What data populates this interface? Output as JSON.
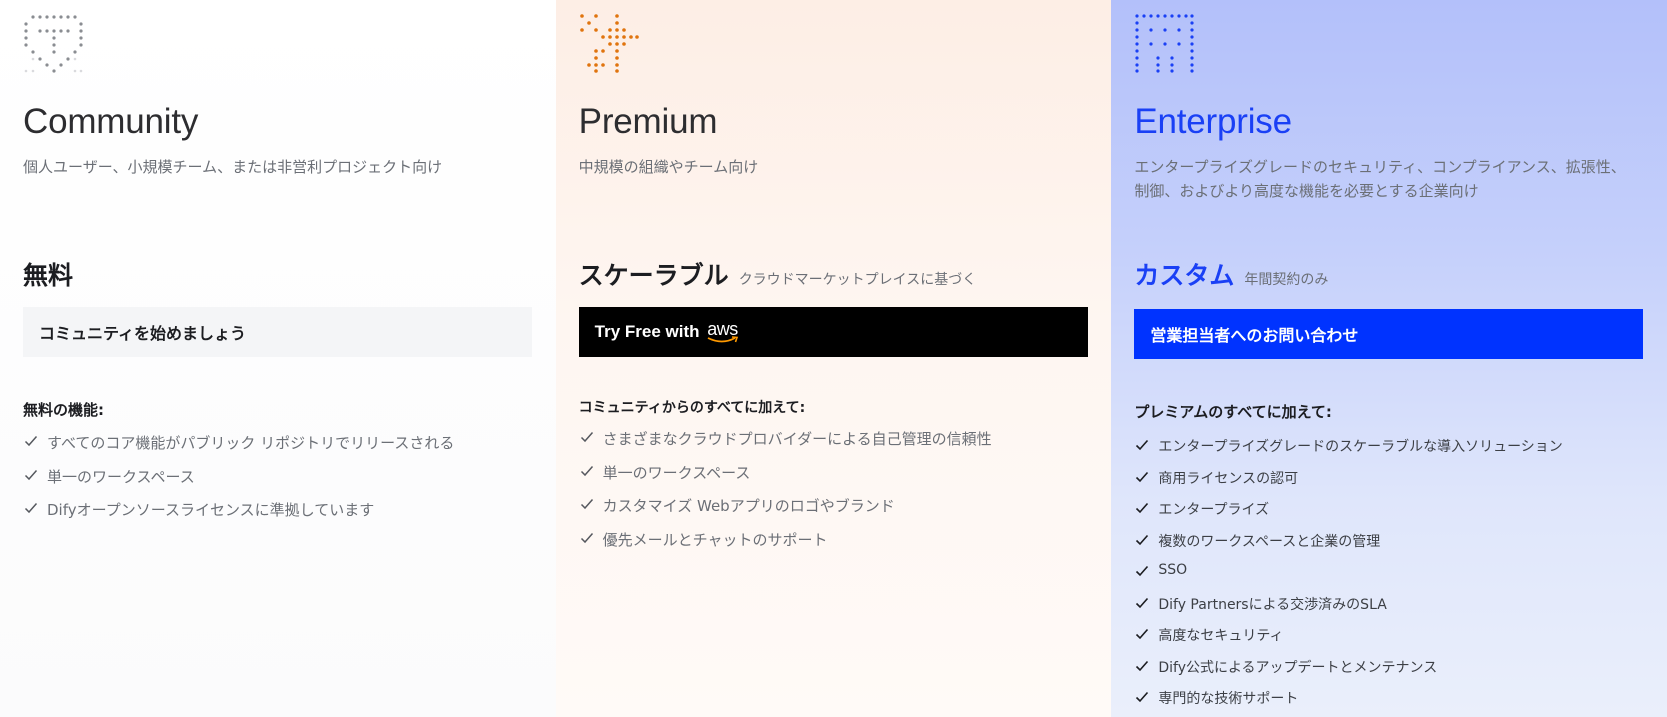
{
  "plans": {
    "community": {
      "name": "Community",
      "description": "個人ユーザー、小規模チーム、または非営利プロジェクト向け",
      "price": "無料",
      "price_note": "",
      "cta_label": "コミュニティを始めましょう",
      "features_title": "無料の機能:",
      "features": [
        "すべてのコア機能がパブリック リポジトリでリリースされる",
        "単一のワークスペース",
        "Difyオープンソースライセンスに準拠しています"
      ],
      "accent_color": "#8a8d92"
    },
    "premium": {
      "name": "Premium",
      "description": "中規模の組織やチーム向け",
      "price": "スケーラブル",
      "price_note": "クラウドマーケットプレイスに基づく",
      "cta_label": "Try Free with",
      "cta_logo_text": "aws",
      "features_title": "コミュニティからのすべてに加えて:",
      "features": [
        "さまざまなクラウドプロバイダーによる自己管理の信頼性",
        "単一のワークスペース",
        "カスタマイズ Webアプリのロゴやブランド",
        "優先メールとチャットのサポート"
      ],
      "accent_color": "#e0740e"
    },
    "enterprise": {
      "name": "Enterprise",
      "description": "エンタープライズグレードのセキュリティ、コンプライアンス、拡張性、制御、およびより高度な機能を必要とする企業向け",
      "price": "カスタム",
      "price_note": "年間契約のみ",
      "cta_label": "営業担当者へのお問い合わせ",
      "features_title": "プレミアムのすべてに加えて:",
      "features": [
        "エンタープライズグレードのスケーラブルな導入ソリューション",
        "商用ライセンスの認可",
        "エンタープライズ",
        "複数のワークスペースと企業の管理",
        "SSO",
        "Dify Partnersによる交渉済みのSLA",
        "高度なセキュリティ",
        "Dify公式によるアップデートとメンテナンス",
        "専門的な技術サポート"
      ],
      "accent_color": "#1a40f5"
    }
  },
  "icons": {
    "community": "shield-dots-icon",
    "premium": "cross-dots-icon",
    "enterprise": "building-dots-icon",
    "check": "check-icon"
  }
}
